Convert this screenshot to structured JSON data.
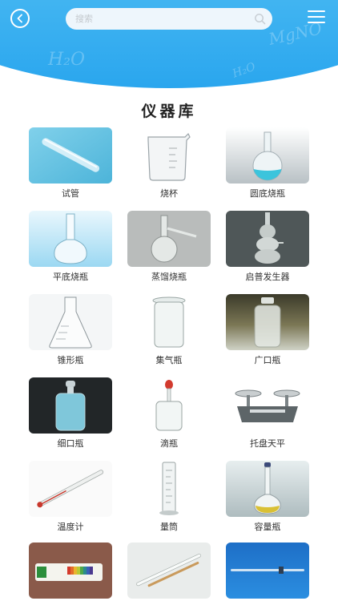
{
  "header": {
    "search_placeholder": "搜索",
    "faint_text_1": "H₂O",
    "faint_text_2": "MgNO",
    "faint_text_3": "H₂O"
  },
  "page": {
    "title": "仪器库"
  },
  "instruments": [
    {
      "label": "试管",
      "icon": "test-tube"
    },
    {
      "label": "烧杯",
      "icon": "beaker"
    },
    {
      "label": "圆底烧瓶",
      "icon": "round-bottom-flask"
    },
    {
      "label": "平底烧瓶",
      "icon": "flat-bottom-flask"
    },
    {
      "label": "蒸馏烧瓶",
      "icon": "distillation-flask"
    },
    {
      "label": "启普发生器",
      "icon": "kipp-generator"
    },
    {
      "label": "锥形瓶",
      "icon": "erlenmeyer-flask"
    },
    {
      "label": "集气瓶",
      "icon": "gas-jar"
    },
    {
      "label": "广口瓶",
      "icon": "wide-mouth-bottle"
    },
    {
      "label": "细口瓶",
      "icon": "narrow-mouth-bottle"
    },
    {
      "label": "滴瓶",
      "icon": "dropper-bottle"
    },
    {
      "label": "托盘天平",
      "icon": "tray-balance"
    },
    {
      "label": "温度计",
      "icon": "thermometer"
    },
    {
      "label": "量筒",
      "icon": "graduated-cylinder"
    },
    {
      "label": "容量瓶",
      "icon": "volumetric-flask"
    },
    {
      "label": "",
      "icon": "ph-test-paper"
    },
    {
      "label": "",
      "icon": "glass-rod"
    },
    {
      "label": "",
      "icon": "burette"
    }
  ]
}
